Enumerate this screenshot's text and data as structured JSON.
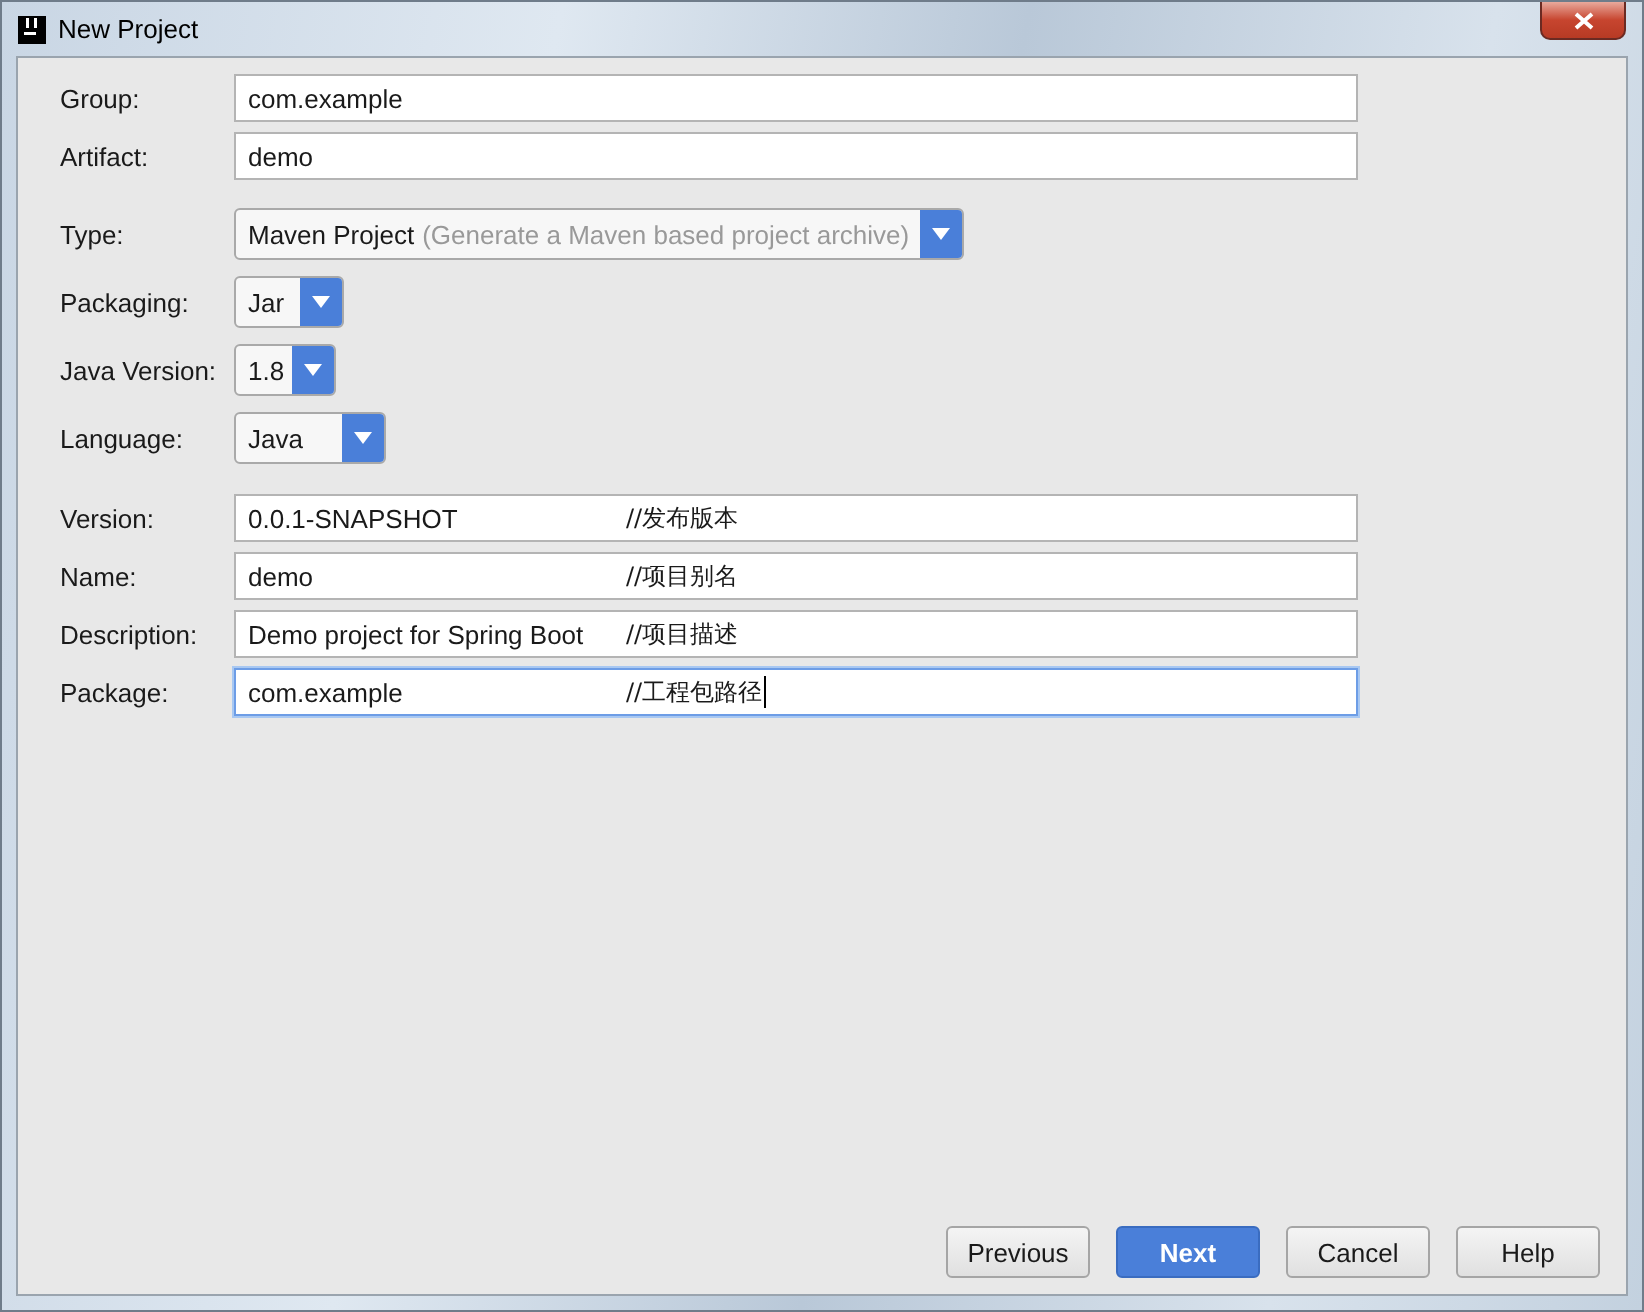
{
  "window": {
    "title": "New Project"
  },
  "top_fields": [
    {
      "label": "Group:",
      "value": "com.example",
      "focused": false
    },
    {
      "label": "Artifact:",
      "value": "demo",
      "focused": false
    }
  ],
  "selects": [
    {
      "label": "Type:",
      "value": "Maven Project",
      "hint": "(Generate a Maven based project archive)"
    },
    {
      "label": "Packaging:",
      "value": "Jar"
    },
    {
      "label": "Java Version:",
      "value": "1.8"
    },
    {
      "label": "Language:",
      "value": "Java"
    }
  ],
  "fields": [
    {
      "label": "Version:",
      "value": "0.0.1-SNAPSHOT",
      "note": "//发布版本",
      "focused": false
    },
    {
      "label": "Name:",
      "value": "demo",
      "note": "//项目别名",
      "focused": false
    },
    {
      "label": "Description:",
      "value": "Demo project for Spring Boot",
      "note": "//项目描述",
      "focused": false
    },
    {
      "label": "Package:",
      "value": "com.example",
      "note": "//工程包路径",
      "focused": true
    }
  ],
  "buttons": [
    {
      "label": "Previous",
      "kind": "normal"
    },
    {
      "label": "Next",
      "kind": "default"
    },
    {
      "label": "Cancel",
      "kind": "normal"
    },
    {
      "label": "Help",
      "kind": "normal"
    }
  ]
}
